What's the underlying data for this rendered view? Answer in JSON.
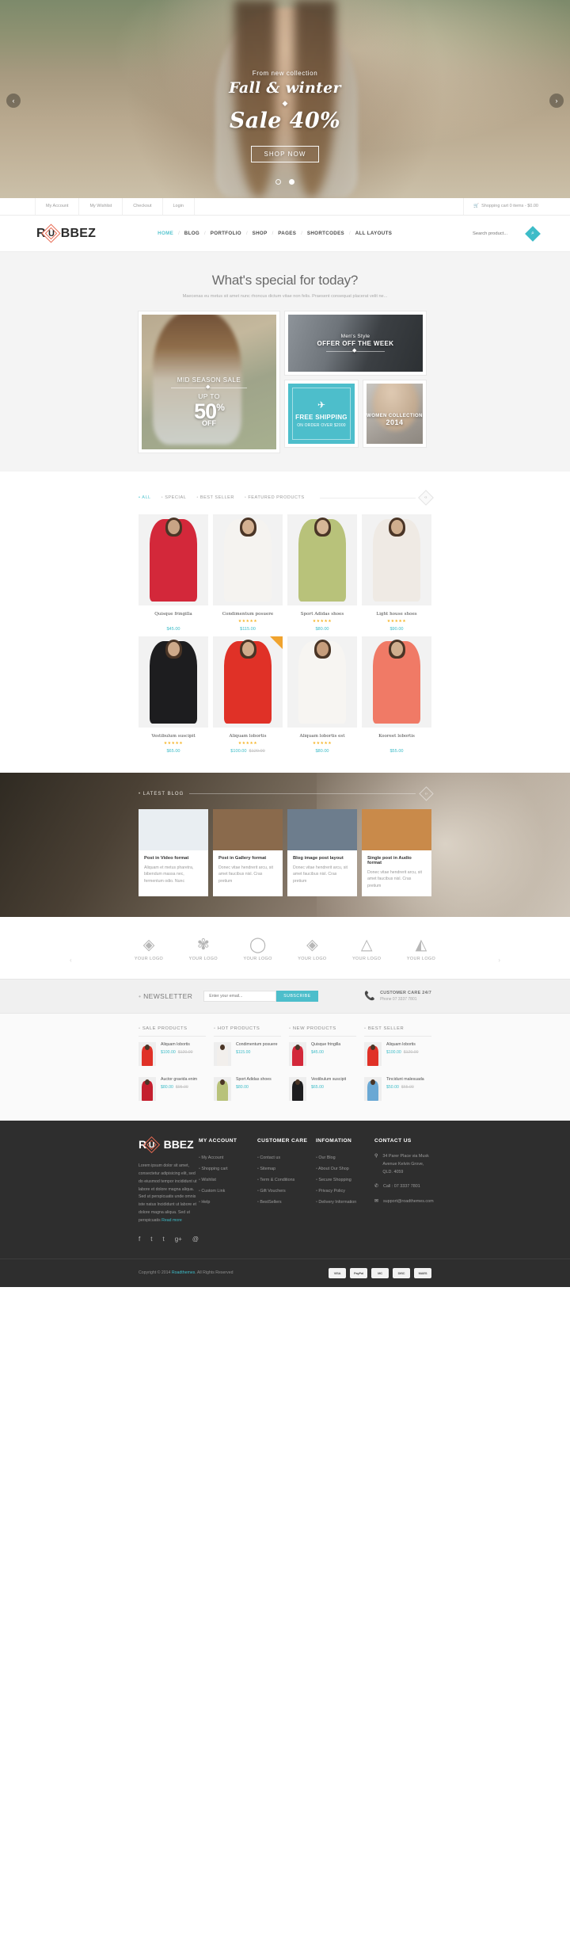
{
  "hero": {
    "sub": "From new collection",
    "script": "Fall & winter",
    "diamond": "◆",
    "big": "Sale 40%",
    "button": "SHOP NOW",
    "prev": "‹",
    "next": "›"
  },
  "topbar": {
    "links": [
      "My Account",
      "My Wishlist",
      "Checkout",
      "Login"
    ],
    "cart_icon": "🛒",
    "cart": "Shopping cart 0 items - $0.00"
  },
  "header": {
    "logo_left": "R",
    "logo_mid": "U",
    "logo_right": "BBEZ",
    "nav": [
      "HOME",
      "BLOG",
      "PORTFOLIO",
      "SHOP",
      "PAGES",
      "SHORTCODES",
      "ALL LAYOUTS"
    ],
    "nav_sep": "/",
    "search_placeholder": "Search product...",
    "search_icon": "⌕"
  },
  "special": {
    "title": "What's special for today?",
    "subtitle": "Maecenas eu metus sit amet nunc rhoncus dictum vitae non felis. Praesent consequat placerat velit ne..."
  },
  "promos": {
    "left": {
      "line1": "MID SEASON SALE",
      "line2": "UP TO",
      "big": "50",
      "sup": "%",
      "off": "OFF"
    },
    "men": {
      "line1": "Men's Style",
      "line2": "OFFER OFF THE WEEK"
    },
    "shipping": {
      "icon": "✈",
      "title": "FREE SHIPPING",
      "sub": "ON ORDER OVER $2000"
    },
    "women": {
      "line1": "WOMEN COLLECTION",
      "line2": "2014"
    }
  },
  "filters": {
    "items": [
      "ALL",
      "SPECIAL",
      "BEST SELLER",
      "FEATURED PRODUCTS"
    ],
    "active": "ALL",
    "nav": "‹›"
  },
  "product_grid": [
    {
      "name": "Quisque fringilla",
      "stars": "",
      "price": "$45.00",
      "old": "",
      "sale": false,
      "dress": "#d3283a",
      "skin": "#c8a485"
    },
    {
      "name": "Condimentum posuere",
      "stars": "★★★★★",
      "price": "$115.00",
      "old": "",
      "sale": false,
      "dress": "#f5f3f0",
      "skin": "#d3b091"
    },
    {
      "name": "Sport Adidas shoes",
      "stars": "★★★★★",
      "price": "$80.00",
      "old": "",
      "sale": false,
      "dress": "#b8c27a",
      "skin": "#d6b696"
    },
    {
      "name": "Light house shoes",
      "stars": "★★★★★",
      "price": "$90.00",
      "old": "",
      "sale": false,
      "dress": "#efeae4",
      "skin": "#cfae8e"
    },
    {
      "name": "Vestibulum suscipit",
      "stars": "★★★★★",
      "price": "$65.00",
      "old": "",
      "sale": false,
      "dress": "#1d1d1f",
      "skin": "#cda98a"
    },
    {
      "name": "Aliquam lobortis",
      "stars": "★★★★★",
      "price": "$100.00",
      "old": "$120.00",
      "sale": true,
      "dress": "#e03127",
      "skin": "#d0ac8c"
    },
    {
      "name": "Aliquam lobortis est",
      "stars": "★★★★★",
      "price": "$80.00",
      "old": "",
      "sale": false,
      "dress": "#f7f5f2",
      "skin": "#c69d7c"
    },
    {
      "name": "Kooreet lobortis",
      "stars": "",
      "price": "$55.00",
      "old": "",
      "sale": false,
      "dress": "#f07a66",
      "skin": "#cfae8e"
    }
  ],
  "blog": {
    "label": "LATEST BLOG",
    "nav": "‹›",
    "posts": [
      {
        "title": "Post in Video format",
        "excerpt": "Aliquam et metus pharetra, bibendum massa nec, fermentum odio. Nunc",
        "thumb": "#e9eef2"
      },
      {
        "title": "Post in Gallery format",
        "excerpt": "Donec vitae hendrerit arcu, sit amet faucibus nisl. Cras pretium",
        "thumb": "#8a6a4c"
      },
      {
        "title": "Blog image post layout",
        "excerpt": "Donec vitae hendrerit arcu, sit amet faucibus nisl. Cras pretium",
        "thumb": "#6d7d8d"
      },
      {
        "title": "Single post in Audio format",
        "excerpt": "Donec vitae hendrerit arcu, sit amet faucibus nisl. Cras pretium",
        "thumb": "#c98a4a"
      }
    ]
  },
  "brands": {
    "prev": "‹",
    "next": "›",
    "items": [
      {
        "mark": "◈",
        "label": "YOUR LOGO"
      },
      {
        "mark": "✾",
        "label": "YOUR LOGO"
      },
      {
        "mark": "◯",
        "label": "YOUR LOGO"
      },
      {
        "mark": "◈",
        "label": "YOUR LOGO"
      },
      {
        "mark": "△",
        "label": "YOUR LOGO"
      },
      {
        "mark": "◭",
        "label": "YOUR LOGO"
      }
    ]
  },
  "newsletter": {
    "title": "NEWSLETTER",
    "placeholder": "Enter your email...",
    "button": "SUBSCRIBE",
    "care_icon": "📞",
    "care_title": "CUSTOMER CARE 24/7",
    "care_phone": "Phone 07 3337 7801"
  },
  "lists": [
    {
      "title": "SALE PRODUCTS",
      "items": [
        {
          "name": "Aliquam lobortis",
          "price": "$100.00",
          "old": "$120.00",
          "dress": "#e03127"
        },
        {
          "name": "Auctor gravida enim",
          "price": "$80.00",
          "old": "$95.00",
          "dress": "#c41f2e"
        }
      ]
    },
    {
      "title": "HOT PRODUCTS",
      "items": [
        {
          "name": "Condimentum posuere",
          "price": "$115.00",
          "old": "",
          "dress": "#f2efec"
        },
        {
          "name": "Sport Adidas shoes",
          "price": "$80.00",
          "old": "",
          "dress": "#b8c27a"
        }
      ]
    },
    {
      "title": "NEW PRODUCTS",
      "items": [
        {
          "name": "Quisque fringilla",
          "price": "$45.00",
          "old": "",
          "dress": "#d3283a"
        },
        {
          "name": "Vestibulum suscipit",
          "price": "$65.00",
          "old": "",
          "dress": "#1d1d1f"
        }
      ]
    },
    {
      "title": "BEST SELLER",
      "items": [
        {
          "name": "Aliquam lobortis",
          "price": "$100.00",
          "old": "$120.00",
          "dress": "#e03127"
        },
        {
          "name": "Tincidunt malesuada",
          "price": "$50.00",
          "old": "$65.00",
          "dress": "#6aa8d4"
        }
      ]
    }
  ],
  "footer": {
    "logo_left": "R",
    "logo_mid": "U",
    "logo_right": "BBEZ",
    "about": "Lorem ipsum dolor sit amet, consectetur adipisicing elit, sed do eiusmod tempor incididunt ut labore et dolore magna aliqua. Sed ut perspicuatis unde omnis iste natus lncididunt ut labore et dolore magna aliqua. Sed ut perspicuatis",
    "read_more": "Read more",
    "social": [
      "f",
      "t",
      "t",
      "g+",
      "@"
    ],
    "columns": [
      {
        "title": "MY ACCOUNT",
        "items": [
          "My Account",
          "Shopping cart",
          "Wishlist",
          "Custom Link",
          "Help"
        ]
      },
      {
        "title": "CUSTOMER CARE",
        "items": [
          "Contact us",
          "Sitemap",
          "Term & Conditions",
          "Gift Vouchers",
          "BestSellers"
        ]
      },
      {
        "title": "INFOMATION",
        "items": [
          "Our Blog",
          "About Our Shop",
          "Secure Shopping",
          "Privacy Policy",
          "Delivery Information"
        ]
      }
    ],
    "contact": {
      "title": "CONTACT US",
      "address_icon": "⚲",
      "address": "34 Parer Place via Musk Avenue Kelvin Grove, QLD. 4059",
      "phone_icon": "✆",
      "phone": "Call : 07 3337 7801",
      "mail_icon": "✉",
      "mail": "support@roadthemes.com"
    },
    "copyright_pre": "Copyright © 2014",
    "copyright_link": "Roadthemes",
    "copyright_post": ". All Rights Reserved",
    "cards": [
      "VISA",
      "PayPal",
      "MC",
      "DISC",
      "MAES"
    ]
  }
}
